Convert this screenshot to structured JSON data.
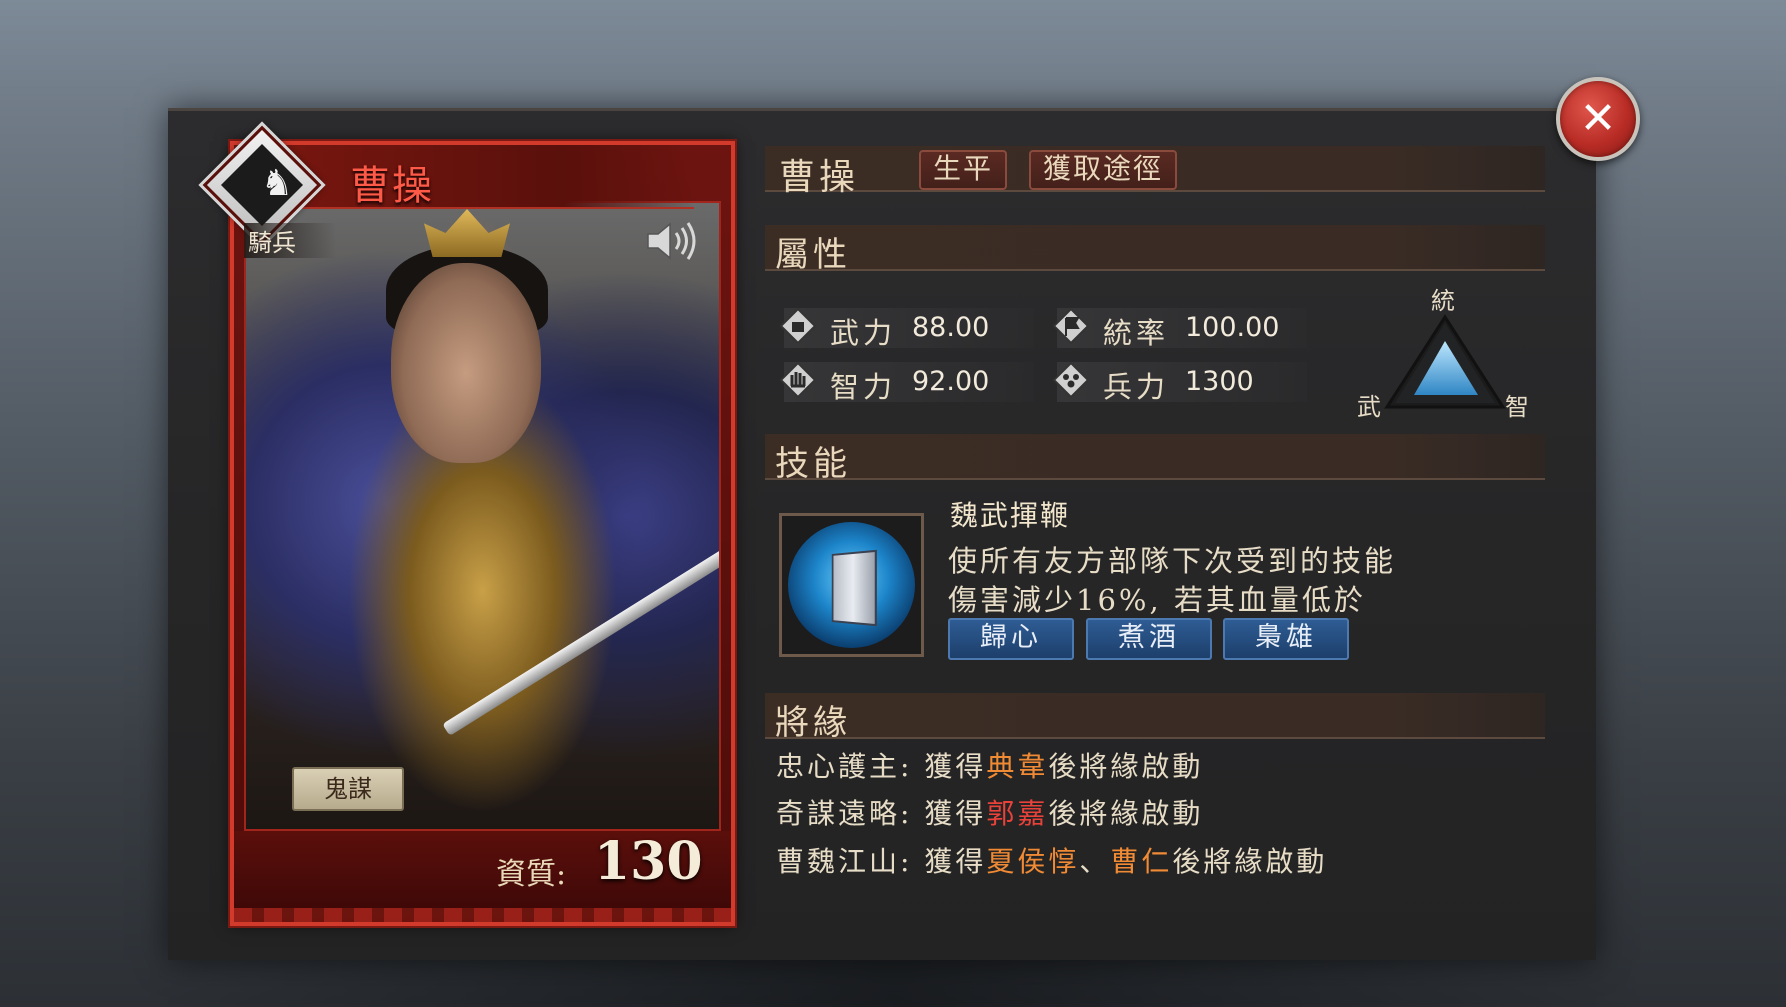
{
  "hero": {
    "name": "曹操",
    "class": "騎兵",
    "tag": "鬼謀",
    "quality_label": "資質",
    "quality_separator": ":",
    "quality_value": "130"
  },
  "header": {
    "hero_name": "曹操",
    "tabs": [
      {
        "label": "生平"
      },
      {
        "label": "獲取途徑"
      }
    ]
  },
  "attributes": {
    "title": "屬性",
    "stats": [
      {
        "label": "武力",
        "value": "88.00",
        "icon": "fist-icon"
      },
      {
        "label": "統率",
        "value": "100.00",
        "icon": "flag-icon"
      },
      {
        "label": "智力",
        "value": "92.00",
        "icon": "hand-icon"
      },
      {
        "label": "兵力",
        "value": "1300",
        "icon": "troops-icon"
      }
    ],
    "triangle": {
      "top": "統",
      "left": "武",
      "right": "智"
    }
  },
  "skills": {
    "title": "技能",
    "name": "魏武揮鞭",
    "description": "使所有友方部隊下次受到的技能傷害減少16%, 若其血量低於",
    "sub_skills": [
      {
        "label": "歸心"
      },
      {
        "label": "煮酒"
      },
      {
        "label": "梟雄"
      }
    ]
  },
  "fates": {
    "title": "將緣",
    "items": [
      {
        "name": "忠心護主",
        "prefix": ": 獲得",
        "heroes": [
          {
            "text": "典韋",
            "color": "orange"
          }
        ],
        "suffix": "後將緣啟動"
      },
      {
        "name": "奇謀遠略",
        "prefix": ": 獲得",
        "heroes": [
          {
            "text": "郭嘉",
            "color": "red"
          }
        ],
        "suffix": "後將緣啟動"
      },
      {
        "name": "曹魏江山",
        "prefix": ": 獲得",
        "heroes": [
          {
            "text": "夏侯惇",
            "color": "orange"
          },
          {
            "text": "、",
            "color": "none"
          },
          {
            "text": "曹仁",
            "color": "orange"
          }
        ],
        "suffix": "後將緣啟動"
      }
    ]
  },
  "colors": {
    "card_border": "#d23a2c",
    "name_red": "#ff5a48",
    "highlight_orange": "#f08a34",
    "highlight_red": "#e8423a",
    "sub_skill_blue": "#2e5c94",
    "close_red": "#b82c25"
  },
  "icons": {
    "close": "close-icon",
    "class": "horse-icon",
    "sound": "speaker-icon"
  }
}
